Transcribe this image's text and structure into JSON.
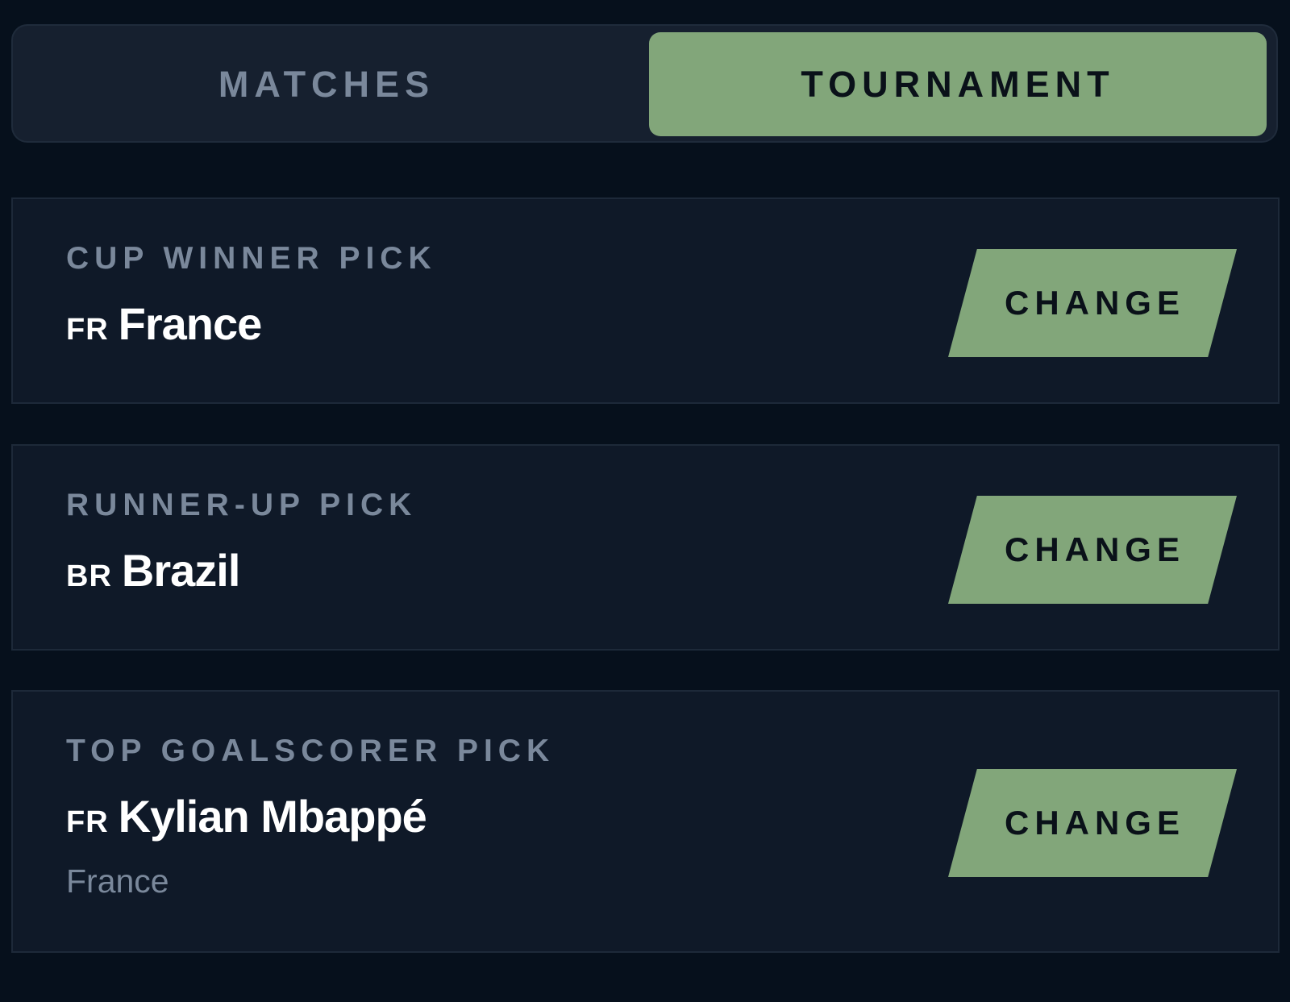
{
  "tabs": [
    {
      "label": "MATCHES",
      "active": false
    },
    {
      "label": "TOURNAMENT",
      "active": true
    }
  ],
  "picks": [
    {
      "label": "CUP WINNER PICK",
      "code": "FR",
      "name": "France",
      "button": "CHANGE"
    },
    {
      "label": "RUNNER-UP PICK",
      "code": "BR",
      "name": "Brazil",
      "button": "CHANGE"
    },
    {
      "label": "TOP GOALSCORER PICK",
      "code": "FR",
      "name": "Kylian Mbappé",
      "subtitle": "France",
      "button": "CHANGE"
    }
  ],
  "colors": {
    "background": "#06101c",
    "card": "#0f1928",
    "accent": "#82a67a",
    "muted_text": "#7a889b",
    "text": "#ffffff"
  }
}
